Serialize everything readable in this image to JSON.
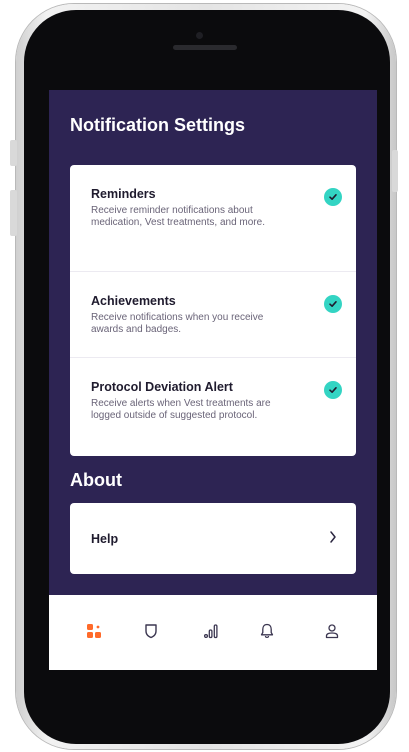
{
  "notification_settings": {
    "title": "Notification Settings",
    "items": [
      {
        "title": "Reminders",
        "description": "Receive reminder notifications about medication, Vest treatments, and more.",
        "enabled": true
      },
      {
        "title": "Achievements",
        "description": "Receive notifications when you receive awards and badges.",
        "enabled": true
      },
      {
        "title": "Protocol Deviation Alert",
        "description": "Receive alerts when Vest treatments are logged outside of suggested protocol.",
        "enabled": true
      }
    ]
  },
  "about": {
    "title": "About",
    "help_label": "Help"
  },
  "tabbar": {
    "tabs": [
      {
        "icon": "dashboard-icon",
        "active": true
      },
      {
        "icon": "shield-icon",
        "active": false
      },
      {
        "icon": "stats-icon",
        "active": false
      },
      {
        "icon": "bell-icon",
        "active": false
      },
      {
        "icon": "profile-icon",
        "active": false
      }
    ]
  },
  "colors": {
    "screen_bg": "#2d2453",
    "accent_check": "#33d4c3",
    "active_tab": "#ff6a2a",
    "tab_icon": "#3b3650"
  }
}
